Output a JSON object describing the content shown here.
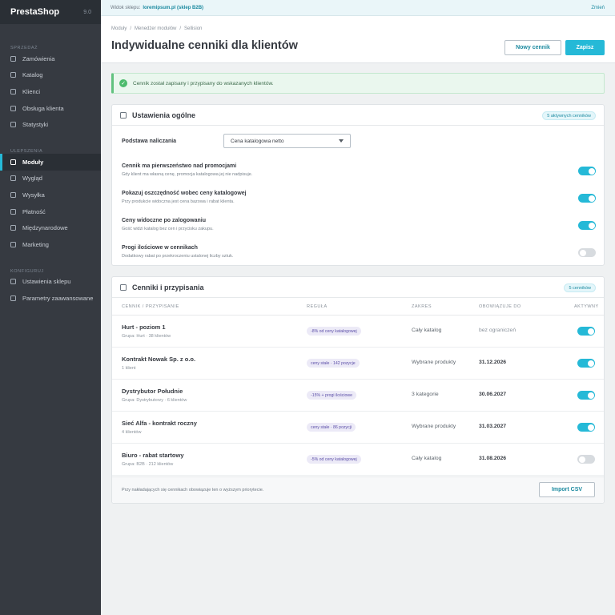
{
  "sidebar": {
    "brand": "PrestaShop",
    "version": "9.0",
    "sections": [
      {
        "label": "SPRZEDAŻ",
        "items": [
          "Zamówienia",
          "Katalog",
          "Klienci",
          "Obsługa klienta",
          "Statystyki"
        ]
      },
      {
        "label": "ULEPSZENIA",
        "items": [
          "Moduły",
          "Wygląd",
          "Wysyłka",
          "Płatność",
          "Międzynarodowe",
          "Marketing"
        ]
      },
      {
        "label": "KONFIGURUJ",
        "items": [
          "Ustawienia sklepu",
          "Parametry zaawansowane"
        ]
      }
    ],
    "active_item": "Moduły"
  },
  "topbar": {
    "shop_label": "Widok sklepu:",
    "shop_value": "loremipsum.pl (sklep B2B)",
    "change_label": "Zmień"
  },
  "header": {
    "breadcrumb": [
      "Moduły",
      "Menedżer modułów",
      "Sellision"
    ],
    "title": "Indywidualne cenniki dla klientów",
    "new_button": "Nowy cennik",
    "save_button": "Zapisz"
  },
  "alert": {
    "text": "Cennik został zapisany i przypisany do wskazanych klientów.",
    "icon": "check-icon",
    "color": "#4cbb6c"
  },
  "general": {
    "title": "Ustawienia ogólne",
    "badge": "5 aktywnych cenników",
    "base_label": "Podstawa naliczania",
    "base_value": "Cena katalogowa netto",
    "settings": [
      {
        "title": "Cennik ma pierwszeństwo nad promocjami",
        "desc": "Gdy klient ma własną cenę, promocja katalogowa jej nie nadpisuje.",
        "enabled": true
      },
      {
        "title": "Pokazuj oszczędność wobec ceny katalogowej",
        "desc": "Przy produkcie widoczna jest cena bazowa i rabat klienta.",
        "enabled": true
      },
      {
        "title": "Ceny widoczne po zalogowaniu",
        "desc": "Gość widzi katalog bez cen i przycisku zakupu.",
        "enabled": true
      },
      {
        "title": "Progi ilościowe w cennikach",
        "desc": "Dodatkowy rabat po przekroczeniu ustalonej liczby sztuk.",
        "enabled": false
      }
    ]
  },
  "pricelists": {
    "title": "Cenniki i przypisania",
    "badge": "5 cenników",
    "columns": {
      "name": "CENNIK / PRZYPISANIE",
      "rule": "REGUŁA",
      "scope": "ZAKRES",
      "valid": "OBOWIĄZUJE DO",
      "active": "AKTYWNY"
    },
    "rows": [
      {
        "name": "Hurt - poziom 1",
        "sub": "Grupa: Hurt · 38 klientów",
        "rule": "-8% od ceny katalogowej",
        "scope": "Cały katalog",
        "valid": "bez ograniczeń",
        "active": true
      },
      {
        "name": "Kontrakt Nowak Sp. z o.o.",
        "sub": "1 klient",
        "rule": "ceny stałe · 142 pozycje",
        "scope": "Wybrane produkty",
        "valid": "31.12.2026",
        "active": true
      },
      {
        "name": "Dystrybutor Południe",
        "sub": "Grupa: Dystrybutorzy · 6 klientów",
        "rule": "-15% + progi ilościowe",
        "scope": "3 kategorie",
        "valid": "30.06.2027",
        "active": true
      },
      {
        "name": "Sieć Alfa - kontrakt roczny",
        "sub": "4 klientów",
        "rule": "ceny stałe · 86 pozycji",
        "scope": "Wybrane produkty",
        "valid": "31.03.2027",
        "active": true
      },
      {
        "name": "Biuro - rabat startowy",
        "sub": "Grupa: B2B · 212 klientów",
        "rule": "-5% od ceny katalogowej",
        "scope": "Cały katalog",
        "valid": "31.08.2026",
        "active": false
      }
    ],
    "footer_note": "Przy nakładających się cennikach obowiązuje ten o wyższym priorytecie.",
    "import_button": "Import CSV"
  },
  "colors": {
    "accent": "#25b9d7",
    "sidebar_bg": "#363a41",
    "success": "#4cbb6c",
    "rule_pill": "#eceaf7"
  }
}
